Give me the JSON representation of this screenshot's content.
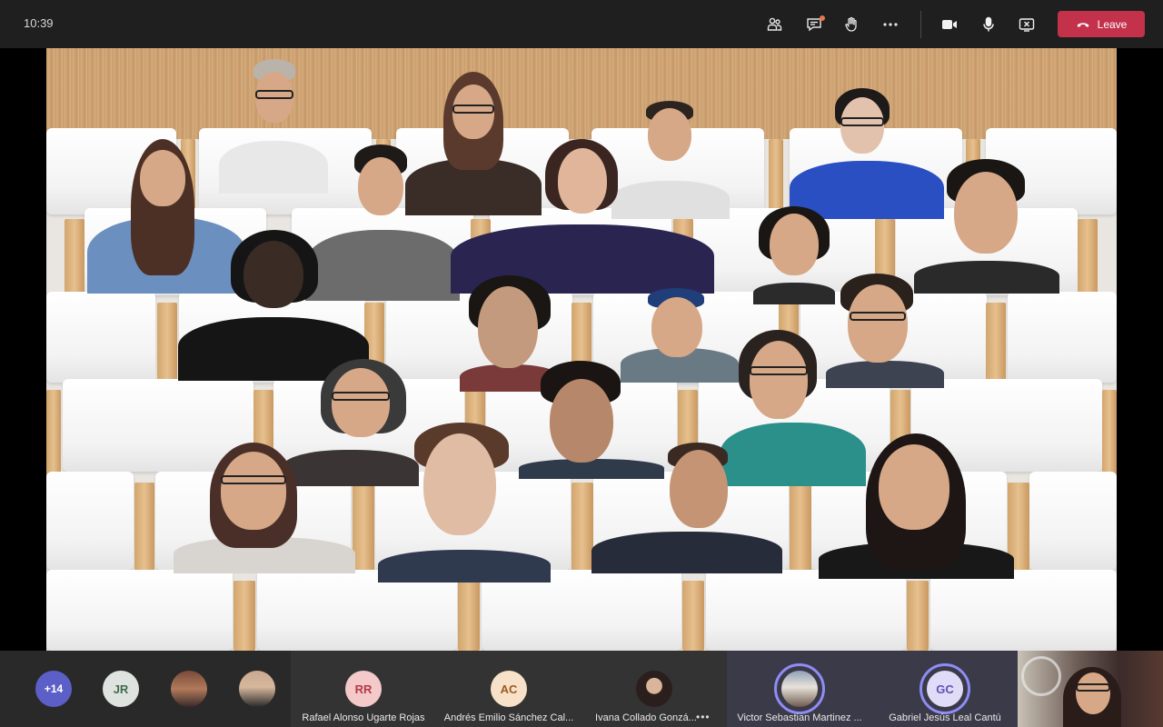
{
  "topbar": {
    "time": "10:39",
    "buttons": [
      {
        "name": "people-icon"
      },
      {
        "name": "chat-icon"
      },
      {
        "name": "raise-hand-icon"
      },
      {
        "name": "more-icon"
      },
      {
        "name": "camera-icon"
      },
      {
        "name": "mic-icon"
      },
      {
        "name": "share-stop-icon"
      }
    ],
    "leave_label": "Leave",
    "accent": "#c4314b",
    "chat_badge_color": "#e97548"
  },
  "roster": {
    "overflow_count": "+14",
    "initials_jr": "JR",
    "tiles": [
      {
        "initials": "RR",
        "name": "Rafael Alonso Ugarte Rojas",
        "avatar_color": "#f3c9c9",
        "text_color": "#b43a47"
      },
      {
        "initials": "AC",
        "name": "Andrés Emilio Sánchez Cal...",
        "avatar_color": "#f7e2c9",
        "text_color": "#9b5b1d"
      },
      {
        "initials": "",
        "name": "Ivana Collado Gonzá...",
        "more": "•••"
      },
      {
        "initials": "",
        "name": "Victor Sebastian Martinez ..."
      },
      {
        "initials": "GC",
        "name": "Gabriel Jesús Leal Cantú",
        "avatar_color": "#e0dbf7",
        "text_color": "#5b52b5"
      }
    ],
    "speaking_ring_color": "#8f8cf5"
  }
}
